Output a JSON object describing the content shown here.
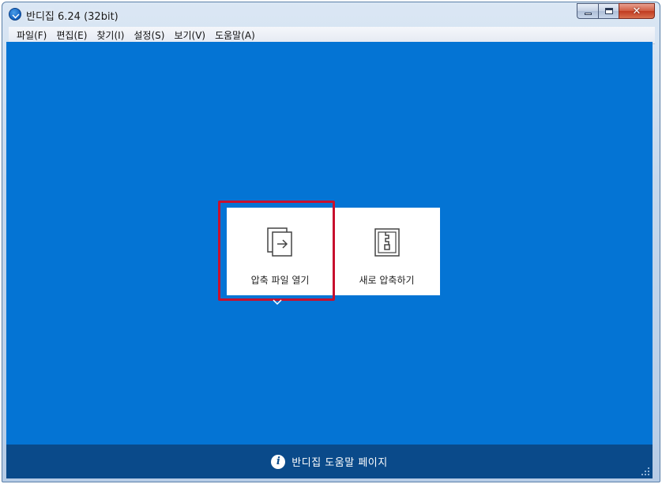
{
  "window": {
    "title": "반디집 6.24 (32bit)",
    "close_glyph": "✕"
  },
  "menu": {
    "items": [
      "파일(F)",
      "편집(E)",
      "찾기(I)",
      "설정(S)",
      "보기(V)",
      "도움말(A)"
    ]
  },
  "actions": {
    "open_label": "압축 파일 열기",
    "new_label": "새로 압축하기"
  },
  "footer": {
    "info_glyph": "i",
    "help_label": "반디집 도움말 페이지"
  },
  "colors": {
    "accent": "#0474d4",
    "footer": "#0a4a8a",
    "highlight": "#c8102e"
  }
}
